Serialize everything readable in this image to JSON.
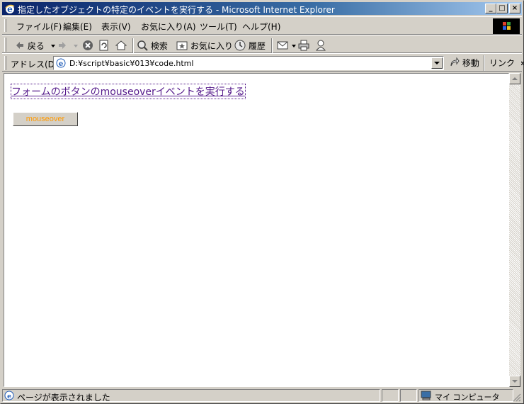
{
  "window": {
    "title": "指定したオブジェクトの特定のイベントを実行する - Microsoft Internet Explorer",
    "minimize_glyph": "_",
    "maximize_glyph": "□",
    "close_glyph": "×"
  },
  "menu": {
    "items": [
      "ファイル(F)",
      "編集(E)",
      "表示(V)",
      "お気に入り(A)",
      "ツール(T)",
      "ヘルプ(H)"
    ]
  },
  "toolbar": {
    "back": "戻る",
    "search": "検索",
    "favorites": "お気に入り",
    "history": "履歴"
  },
  "address": {
    "label": "アドレス(D)",
    "url": "D:¥script¥basic¥013¥code.html",
    "go": "移動",
    "links": "リンク",
    "links_chevron": "»"
  },
  "page": {
    "link_text": "フォームのボタンのmouseoverイベントを実行する",
    "button_label": "mouseover"
  },
  "status": {
    "text": "ページが表示されました",
    "zone": "マイ コンピュータ"
  },
  "colors": {
    "title_start": "#0a246a",
    "title_end": "#a6caf0",
    "visited_link": "#551a8b",
    "button_text": "#ff9900",
    "chrome": "#d4d0c8"
  }
}
